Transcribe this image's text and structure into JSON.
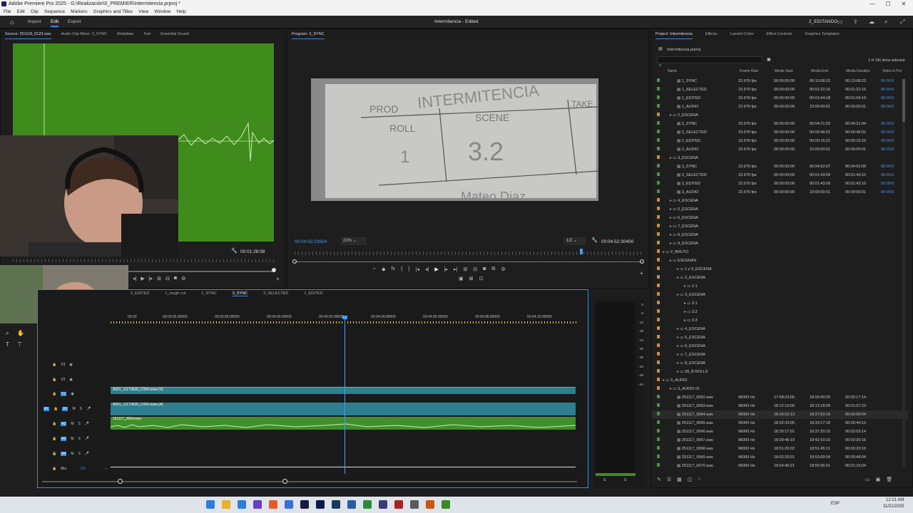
{
  "app": {
    "title": "Adobe Premiere Pro 2025 - G:\\Realización\\0_PREMIER\\Intermitencia.prproj *"
  },
  "menu": [
    "File",
    "Edit",
    "Clip",
    "Sequence",
    "Markers",
    "Graphics and Titles",
    "View",
    "Window",
    "Help"
  ],
  "header": {
    "home": "home-icon",
    "workspaces": [
      "Import",
      "Edit",
      "Export"
    ],
    "active": "Edit",
    "center": "Intermitencia - Edited",
    "user": "2_EDITANDO"
  },
  "source": {
    "tabs": [
      "Source: 251118_0123.wav",
      "Audio Clip Mixer: 3_SYNC",
      "Metadata",
      "Text",
      "Essential Sound"
    ],
    "timecode": "00:01:28:08"
  },
  "program": {
    "tab": "Program: 3_SYNC",
    "timecode": "00:04:02:23914",
    "zoom": "21%",
    "quality": "1/2",
    "duration": "00:04:52:30400",
    "slate": {
      "prod": "PROD",
      "title": "INTERMITENCIA",
      "roll": "ROLL",
      "scene": "SCENE",
      "take": "TAKE",
      "roll_val": "1",
      "scene_val": "3.2",
      "name": "Mateo Diaz"
    }
  },
  "timeline": {
    "tabs": [
      "2_EDITED",
      "1_rough cut",
      "1_SYNC",
      "3_SYNC",
      "3_SELECTED",
      "1_EDITED"
    ],
    "active": "3_SYNC",
    "ruler": [
      "00:00",
      "00:03:56:00000",
      "00:03:58:00000",
      "00:04:00:00000",
      "00:04:02:00000",
      "00:04:04:00000",
      "00:04:06:00000",
      "00:04:08:00000",
      "00:04:10:00000"
    ],
    "tracks": [
      {
        "n": "V3"
      },
      {
        "n": "V2"
      },
      {
        "n": "V1"
      },
      {
        "n": "A1"
      },
      {
        "n": "A2"
      },
      {
        "n": "A3"
      },
      {
        "n": "A4"
      },
      {
        "n": "Mix"
      }
    ],
    "clips": {
      "v1": "A001_11170628_C004.braw [V]",
      "a1": "A001_11170628_C004.braw [A]",
      "a2": "251117_0064.wav"
    },
    "mix_val": "0.0",
    "m": "M",
    "s": "S"
  },
  "meter": {
    "scale": [
      "0",
      "-6",
      "-12",
      "-18",
      "-24",
      "-30",
      "-36",
      "-42",
      "-48",
      "-54"
    ],
    "lr": [
      "S",
      "S"
    ]
  },
  "project": {
    "tabs": [
      "Project: Intermitencia",
      "Effects",
      "Lumetri Color",
      "Effect Controls",
      "Graphics Templates"
    ],
    "file": "Intermitencia.prproj",
    "count": "1 of 106 items selected",
    "cols": [
      "Name",
      "Frame Rate",
      "Media Start",
      "Media End",
      "Media Duration",
      "Video In Poi"
    ],
    "rows": [
      {
        "i": 2,
        "name": "1_SYNC",
        "fr": "23.976 fps",
        "ms": "00:00:00:00",
        "me": "00:13:08:22",
        "md": "00:13:08:23",
        "vi": "00:00:0"
      },
      {
        "i": 2,
        "name": "1_SELECTED",
        "fr": "23.976 fps",
        "ms": "00:00:00:00",
        "me": "00:01:22:16",
        "md": "00:01:22:16",
        "vi": "00:00:0"
      },
      {
        "i": 2,
        "name": "1_EDITED",
        "fr": "23.976 fps",
        "ms": "00:00:00:00",
        "me": "00:01:04:18",
        "md": "00:01:04:19",
        "vi": "00:00:0"
      },
      {
        "i": 2,
        "name": "1_AUDIO",
        "fr": "23.976 fps",
        "ms": "00:00:00:00",
        "me": "23:00:00:01",
        "md": "00:00:00:01",
        "vi": "00:00:0"
      },
      {
        "i": 1,
        "name": "2_ESCENA",
        "bin": true
      },
      {
        "i": 2,
        "name": "2_SYNC",
        "fr": "23.976 fps",
        "ms": "00:00:00:00",
        "me": "00:04:21:03",
        "md": "00:04:21:04",
        "vi": "00:00:0"
      },
      {
        "i": 2,
        "name": "2_SELECTED",
        "fr": "23.976 fps",
        "ms": "00:00:00:00",
        "me": "00:00:46:01",
        "md": "00:00:46:02",
        "vi": "00:00:0"
      },
      {
        "i": 2,
        "name": "2_EDITED",
        "fr": "23.976 fps",
        "ms": "00:00:00:00",
        "me": "00:00:16:22",
        "md": "00:00:16:23",
        "vi": "00:00:0"
      },
      {
        "i": 2,
        "name": "2_AUDIO",
        "fr": "23.976 fps",
        "ms": "00:00:00:00",
        "me": "23:00:00:01",
        "md": "00:00:00:01",
        "vi": "00:00:0"
      },
      {
        "i": 1,
        "name": "3_ESCENA",
        "bin": true
      },
      {
        "i": 2,
        "name": "3_SYNC",
        "fr": "23.976 fps",
        "ms": "00:00:00:00",
        "me": "00:04:52:07",
        "md": "00:04:52:08",
        "vi": "00:00:0"
      },
      {
        "i": 2,
        "name": "3_SELECTED",
        "fr": "23.976 fps",
        "ms": "00:00:00:00",
        "me": "00:01:43:09",
        "md": "00:01:43:10",
        "vi": "00:00:0"
      },
      {
        "i": 2,
        "name": "3_EDITED",
        "fr": "23.976 fps",
        "ms": "00:00:00:00",
        "me": "00:01:43:09",
        "md": "00:01:43:10",
        "vi": "00:00:0"
      },
      {
        "i": 2,
        "name": "3_AUDIO",
        "fr": "23.976 fps",
        "ms": "00:00:00:00",
        "me": "23:00:00:01",
        "md": "00:00:00:01",
        "vi": "00:00:0"
      },
      {
        "i": 1,
        "name": "4_ESCENA",
        "bin": true
      },
      {
        "i": 1,
        "name": "5_ESCENA",
        "bin": true
      },
      {
        "i": 1,
        "name": "6_ESCENA",
        "bin": true
      },
      {
        "i": 1,
        "name": "7_ESCENA",
        "bin": true
      },
      {
        "i": 1,
        "name": "8_ESCENA",
        "bin": true
      },
      {
        "i": 1,
        "name": "9_ESCENA",
        "bin": true
      },
      {
        "i": 0,
        "name": "2_BRUTO",
        "bin": true
      },
      {
        "i": 1,
        "name": "ESCENAS",
        "bin": true
      },
      {
        "i": 2,
        "name": "1 y 9_ESCENA",
        "bin": true
      },
      {
        "i": 2,
        "name": "2_ESCENA",
        "bin": true
      },
      {
        "i": 3,
        "name": "2.1",
        "bin": true
      },
      {
        "i": 2,
        "name": "3_ESCENA",
        "bin": true
      },
      {
        "i": 3,
        "name": "3.1",
        "bin": true
      },
      {
        "i": 3,
        "name": "3.2",
        "bin": true
      },
      {
        "i": 3,
        "name": "3.3",
        "bin": true
      },
      {
        "i": 2,
        "name": "4_ESCENA",
        "bin": true
      },
      {
        "i": 2,
        "name": "5_ESCENA",
        "bin": true
      },
      {
        "i": 2,
        "name": "6_ESCENA",
        "bin": true
      },
      {
        "i": 2,
        "name": "7_ESCENA",
        "bin": true
      },
      {
        "i": 2,
        "name": "8_ESCENA",
        "bin": true
      },
      {
        "i": 2,
        "name": "99_B ROLLS",
        "bin": true
      },
      {
        "i": 0,
        "name": "3_AUDIO",
        "bin": true
      },
      {
        "i": 1,
        "name": "3_AUDIO 01",
        "bin": true
      },
      {
        "i": 2,
        "name": "251117_0062.wav",
        "fr": "96000 Hz",
        "ms": "17:58:23:06",
        "me": "18:00:40:20",
        "md": "00:02:17:14",
        "vi": ""
      },
      {
        "i": 2,
        "name": "251117_0063.wav",
        "fr": "96000 Hz",
        "ms": "18:12:10:00",
        "me": "18:13:18:09",
        "md": "00:01:07:23",
        "vi": ""
      },
      {
        "i": 2,
        "name": "251117_0064.wav",
        "fr": "96000 Hz",
        "ms": "18:26:52:13",
        "me": "18:27:53:16",
        "md": "00:00:59:04",
        "vi": "",
        "sel": true
      },
      {
        "i": 2,
        "name": "251117_0065.wav",
        "fr": "96000 Hz",
        "ms": "18:32:33:05",
        "me": "18:33:17:18",
        "md": "00:00:44:13",
        "vi": ""
      },
      {
        "i": 2,
        "name": "251117_0066.wav",
        "fr": "96000 Hz",
        "ms": "18:35:17:01",
        "me": "18:37:20:15",
        "md": "00:02:03:14",
        "vi": ""
      },
      {
        "i": 2,
        "name": "251117_0067.wav",
        "fr": "96000 Hz",
        "ms": "18:39:49:19",
        "me": "18:42:10:10",
        "md": "00:02:20:16",
        "vi": ""
      },
      {
        "i": 2,
        "name": "251117_0068.wav",
        "fr": "96000 Hz",
        "ms": "18:51:25:02",
        "me": "18:51:45:11",
        "md": "00:00:20:10",
        "vi": ""
      },
      {
        "i": 2,
        "name": "251117_0069.wav",
        "fr": "96000 Hz",
        "ms": "18:52:20:01",
        "me": "18:53:09:04",
        "md": "00:00:49:04",
        "vi": ""
      },
      {
        "i": 2,
        "name": "251117_0070.wav",
        "fr": "96000 Hz",
        "ms": "18:54:40:21",
        "me": "18:55:56:01",
        "md": "00:01:15:04",
        "vi": ""
      }
    ]
  },
  "taskbar": {
    "lang": "ESP",
    "time": "12:21 AM",
    "date": "11/21/2025",
    "colors": [
      "#2d7de0",
      "#e8b02c",
      "#2d7de0",
      "#6a3dc8",
      "#e55b2a",
      "#3a6fd8",
      "#1a1a3a",
      "#0a1a4a",
      "#1a3a5a",
      "#2b5aa8",
      "#2a8a3a",
      "#3a3a7a",
      "#aa2222",
      "#5a5a5a",
      "#cc5511",
      "#3a8a2a"
    ]
  }
}
